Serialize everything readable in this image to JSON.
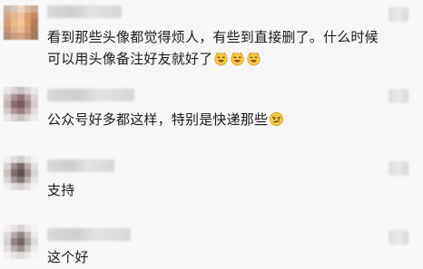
{
  "comments": [
    {
      "line1": "看到那些头像都觉得烦人，有些到直接删了。什么时候",
      "line2": "可以用头像备注好友就好了",
      "emojis": [
        "laughing-cat-icon",
        "laughing-cat-icon",
        "laughing-cat-icon"
      ]
    },
    {
      "line1": "公众号好多都这样，特别是快递那些",
      "emojis": [
        "smirk-face-icon"
      ]
    },
    {
      "line1": "支持"
    },
    {
      "line1": "这个好"
    }
  ],
  "colors": {
    "background": "#f7f7f7",
    "text": "#1a1a1a",
    "emoji_face": "#f6c744"
  }
}
